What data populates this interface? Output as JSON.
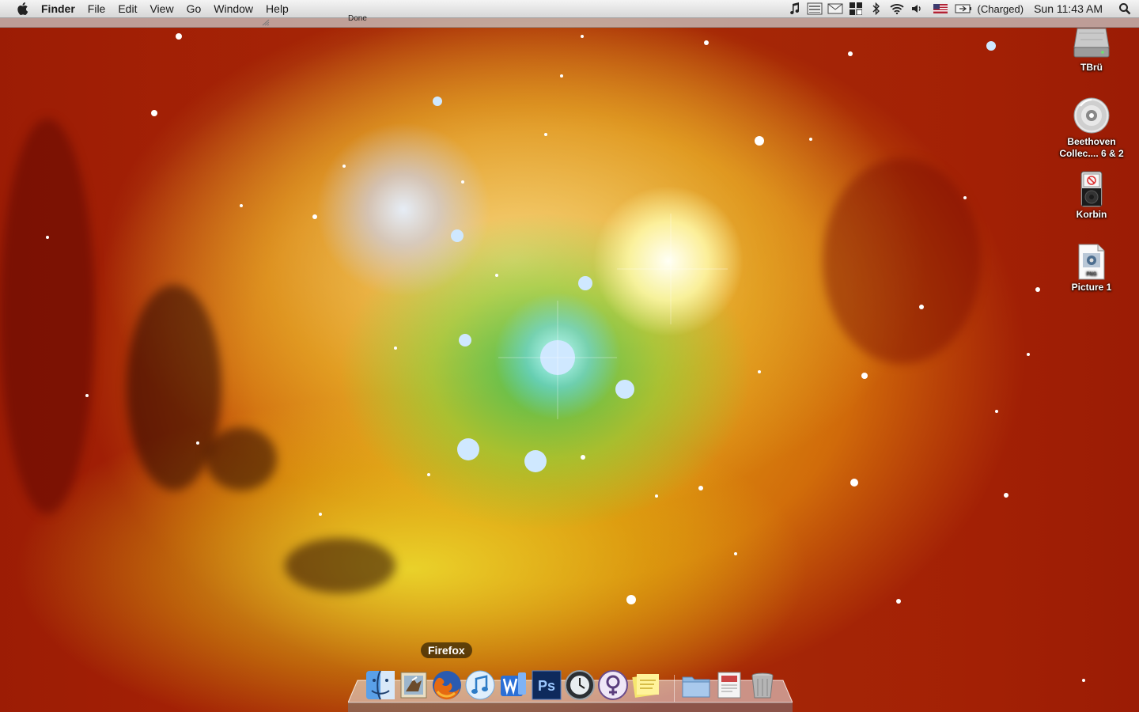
{
  "menubar": {
    "app_name": "Finder",
    "menus": [
      "File",
      "Edit",
      "View",
      "Go",
      "Window",
      "Help"
    ],
    "battery_status": "(Charged)",
    "clock": "Sun 11:43 AM"
  },
  "status_strip": {
    "label": "Done"
  },
  "desktop_icons": [
    {
      "label": "TBrü",
      "icon": "hard-drive-icon"
    },
    {
      "label": "Beethoven Collec.... 6 & 2",
      "icon": "cd-icon"
    },
    {
      "label": "Korbin",
      "icon": "ipod-icon"
    },
    {
      "label": "Picture 1",
      "icon": "png-file-icon"
    }
  ],
  "dock": {
    "tooltip": "Firefox",
    "apps": [
      "Finder",
      "Mail",
      "Firefox",
      "iTunes",
      "Word",
      "Photoshop",
      "Time Machine",
      "Adium",
      "Stickies",
      "Documents",
      "Preview",
      "Trash"
    ]
  },
  "colors": {
    "menubar_top": "#f4f4f4",
    "menubar_bottom": "#d7d7d7",
    "photoshop_blue": "#0e2a5c",
    "firefox_orange": "#e66a10"
  }
}
